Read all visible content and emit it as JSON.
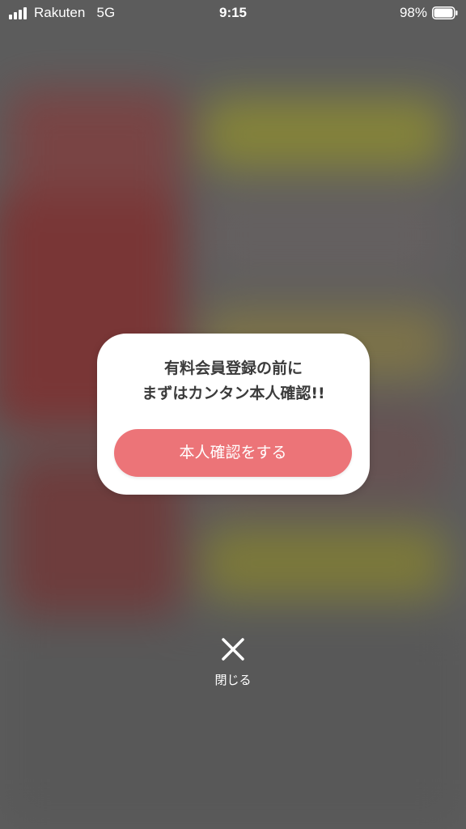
{
  "status_bar": {
    "carrier": "Rakuten",
    "network": "5G",
    "time": "9:15",
    "battery_percent": "98%",
    "battery_level": 0.98,
    "signal_bars": 4
  },
  "modal": {
    "message_line1": "有料会員登録の前に",
    "message_line2": "まずはカンタン本人確認!!",
    "verify_button_label": "本人確認をする",
    "button_color": "#ec7478"
  },
  "close": {
    "icon": "close-icon",
    "label": "閉じる"
  }
}
